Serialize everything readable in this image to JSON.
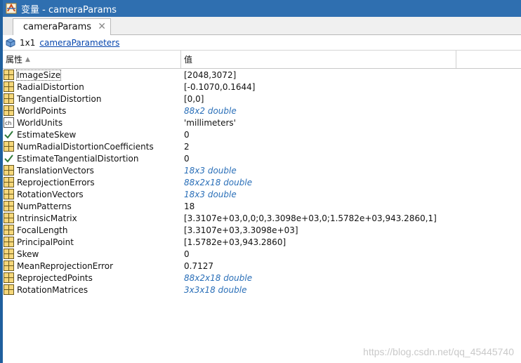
{
  "window": {
    "title": "变量 - cameraParams"
  },
  "tabs": [
    {
      "label": "cameraParams",
      "close": "✕"
    }
  ],
  "info": {
    "size": "1x1",
    "class_link": "cameraParameters"
  },
  "columns": {
    "property": "属性",
    "value": "值"
  },
  "rows": [
    {
      "name": "ImageSize",
      "value": "[2048,3072]",
      "icon": "grid-icon",
      "dim": false
    },
    {
      "name": "RadialDistortion",
      "value": "[-0.1070,0.1644]",
      "icon": "grid-icon",
      "dim": false
    },
    {
      "name": "TangentialDistortion",
      "value": "[0,0]",
      "icon": "grid-icon",
      "dim": false
    },
    {
      "name": "WorldPoints",
      "value": "88x2 double",
      "icon": "grid-icon",
      "dim": true
    },
    {
      "name": "WorldUnits",
      "value": "'millimeters'",
      "icon": "char-icon",
      "dim": false
    },
    {
      "name": "EstimateSkew",
      "value": "0",
      "icon": "check-icon",
      "dim": false
    },
    {
      "name": "NumRadialDistortionCoefficients",
      "value": "2",
      "icon": "grid-icon",
      "dim": false
    },
    {
      "name": "EstimateTangentialDistortion",
      "value": "0",
      "icon": "check-icon",
      "dim": false
    },
    {
      "name": "TranslationVectors",
      "value": "18x3 double",
      "icon": "grid-icon",
      "dim": true
    },
    {
      "name": "ReprojectionErrors",
      "value": "88x2x18 double",
      "icon": "grid-icon",
      "dim": true
    },
    {
      "name": "RotationVectors",
      "value": "18x3 double",
      "icon": "grid-icon",
      "dim": true
    },
    {
      "name": "NumPatterns",
      "value": "18",
      "icon": "grid-icon",
      "dim": false
    },
    {
      "name": "IntrinsicMatrix",
      "value": "[3.3107e+03,0,0;0,3.3098e+03,0;1.5782e+03,943.2860,1]",
      "icon": "grid-icon",
      "dim": false
    },
    {
      "name": "FocalLength",
      "value": "[3.3107e+03,3.3098e+03]",
      "icon": "grid-icon",
      "dim": false
    },
    {
      "name": "PrincipalPoint",
      "value": "[1.5782e+03,943.2860]",
      "icon": "grid-icon",
      "dim": false
    },
    {
      "name": "Skew",
      "value": "0",
      "icon": "grid-icon",
      "dim": false
    },
    {
      "name": "MeanReprojectionError",
      "value": "0.7127",
      "icon": "grid-icon",
      "dim": false
    },
    {
      "name": "ReprojectedPoints",
      "value": "88x2x18 double",
      "icon": "grid-icon",
      "dim": true
    },
    {
      "name": "RotationMatrices",
      "value": "3x3x18 double",
      "icon": "grid-icon",
      "dim": true
    }
  ],
  "watermark": "https://blog.csdn.net/qq_45445740",
  "colors": {
    "titlebar": "#2f6fb0",
    "link": "#0645ad",
    "dim_value": "#2a6fb8",
    "grid_icon_fill": "#f5d77a",
    "grid_icon_stroke": "#6b5a1e"
  }
}
